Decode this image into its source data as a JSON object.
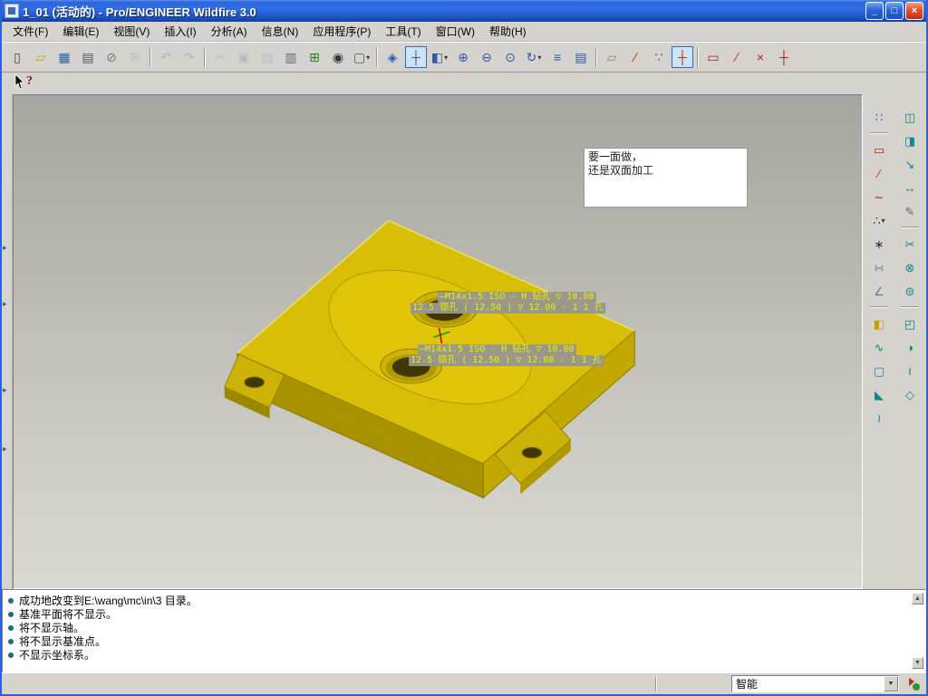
{
  "window": {
    "title": "1_01 (活动的) - Pro/ENGINEER Wildfire 3.0",
    "minimize_glyph": "_",
    "maximize_glyph": "□",
    "close_glyph": "×"
  },
  "menu": {
    "items": [
      {
        "id": "file",
        "label": "文件(F)"
      },
      {
        "id": "edit",
        "label": "编辑(E)"
      },
      {
        "id": "view",
        "label": "视图(V)"
      },
      {
        "id": "insert",
        "label": "插入(I)"
      },
      {
        "id": "analysis",
        "label": "分析(A)"
      },
      {
        "id": "info",
        "label": "信息(N)"
      },
      {
        "id": "applications",
        "label": "应用程序(P)"
      },
      {
        "id": "tools",
        "label": "工具(T)"
      },
      {
        "id": "window",
        "label": "窗口(W)"
      },
      {
        "id": "help",
        "label": "帮助(H)"
      }
    ]
  },
  "toolbar": {
    "caret_glyph": "▾",
    "groups": [
      {
        "items": [
          {
            "name": "new-file-button",
            "glyph": "▯",
            "color": "#444444"
          },
          {
            "name": "open-file-button",
            "glyph": "▱",
            "color": "#c8a000"
          },
          {
            "name": "save-file-button",
            "glyph": "▦",
            "color": "#2a5caa"
          },
          {
            "name": "print-button",
            "glyph": "▤",
            "color": "#555555"
          },
          {
            "name": "erase-display-button",
            "glyph": "⊘",
            "color": "#777777"
          },
          {
            "name": "send-email-button",
            "glyph": "✉",
            "color": "#999999",
            "disabled": true
          }
        ]
      },
      {
        "items": [
          {
            "name": "undo-button",
            "glyph": "↶",
            "color": "#888888",
            "disabled": true
          },
          {
            "name": "redo-button",
            "glyph": "↷",
            "color": "#888888",
            "disabled": true
          }
        ]
      },
      {
        "items": [
          {
            "name": "cut-button",
            "glyph": "✂",
            "color": "#999999",
            "disabled": true
          },
          {
            "name": "copy-button",
            "glyph": "▣",
            "color": "#999999",
            "disabled": true
          },
          {
            "name": "paste-button",
            "glyph": "▤",
            "color": "#999999",
            "disabled": true
          },
          {
            "name": "paste-special-button",
            "glyph": "▥",
            "color": "#666677"
          },
          {
            "name": "regenerate-button",
            "glyph": "⊞",
            "color": "#2a7a2a"
          },
          {
            "name": "find-button",
            "glyph": "◉",
            "color": "#333333"
          },
          {
            "name": "select-box-button",
            "glyph": "▢",
            "color": "#555555",
            "caret": true
          }
        ]
      },
      {
        "items": [
          {
            "name": "repaint-button",
            "glyph": "◈",
            "color": "#2a5caa"
          },
          {
            "name": "spin-center-toggle",
            "glyph": "┼",
            "color": "#2a5caa",
            "pressed": true
          },
          {
            "name": "saved-views-button",
            "glyph": "◧",
            "color": "#2a5caa",
            "caret": true
          },
          {
            "name": "zoom-in-button",
            "glyph": "⊕",
            "color": "#2a5caa"
          },
          {
            "name": "zoom-out-button",
            "glyph": "⊖",
            "color": "#2a5caa"
          },
          {
            "name": "refit-button",
            "glyph": "⊙",
            "color": "#2a5caa"
          },
          {
            "name": "reorient-button",
            "glyph": "↻",
            "color": "#2a5caa",
            "caret": true
          },
          {
            "name": "layers-button",
            "glyph": "≡",
            "color": "#2a5caa"
          },
          {
            "name": "view-manager-button",
            "glyph": "▤",
            "color": "#2a5caa"
          }
        ]
      },
      {
        "items": [
          {
            "name": "datum-planes-toggle",
            "glyph": "▱",
            "color": "#a07850"
          },
          {
            "name": "datum-axes-toggle",
            "glyph": "∕",
            "color": "#b03000"
          },
          {
            "name": "datum-points-toggle",
            "glyph": "∵",
            "color": "#2a5caa"
          },
          {
            "name": "datum-csys-toggle",
            "glyph": "┼",
            "color": "#b03000",
            "pressed": true
          }
        ]
      },
      {
        "items": [
          {
            "name": "create-datum-plane-button",
            "glyph": "▭",
            "color": "#aa2222"
          },
          {
            "name": "create-datum-axis-button",
            "glyph": "∕",
            "color": "#aa2222"
          },
          {
            "name": "create-datum-point-button",
            "glyph": "×",
            "color": "#aa2222"
          },
          {
            "name": "create-datum-csys-button",
            "glyph": "┼",
            "color": "#aa2222"
          }
        ]
      }
    ]
  },
  "cursor": {
    "help_glyph": "?"
  },
  "left_panel": {
    "arrow_glyph": "▸"
  },
  "right_toolbar": {
    "col_a": [
      {
        "name": "select-special-tool",
        "glyph": "∷",
        "color": "#2a5caa"
      },
      {
        "sep": true
      },
      {
        "name": "datum-plane-tool",
        "glyph": "▭",
        "color": "#b03000"
      },
      {
        "name": "datum-axis-tool",
        "glyph": "∕",
        "color": "#b03000"
      },
      {
        "name": "datum-curve-tool",
        "glyph": "∼",
        "color": "#b03000"
      },
      {
        "name": "datum-point-tool",
        "glyph": "∴",
        "color": "#333333",
        "caret": true
      },
      {
        "name": "datum-csys-tool",
        "glyph": "∗",
        "color": "#333333"
      },
      {
        "name": "reference-tool",
        "glyph": "∺",
        "color": "#777777"
      },
      {
        "name": "measure-tool",
        "glyph": "∠",
        "color": "#777777"
      },
      {
        "sep": true
      },
      {
        "name": "layer-tool",
        "glyph": "◧",
        "color": "#c8a000"
      },
      {
        "name": "graph-tool",
        "glyph": "∿",
        "color": "#0a8a8a"
      },
      {
        "name": "sketch-tool",
        "glyph": "▢",
        "color": "#0a8a8a"
      },
      {
        "name": "flag-annotation-tool",
        "glyph": "◣",
        "color": "#0a8a8a"
      },
      {
        "name": "curve-edit-tool",
        "glyph": "≀",
        "color": "#0a8a8a"
      }
    ],
    "col_b": [
      {
        "name": "copy-geometry-tool",
        "glyph": "◫",
        "color": "#0a8a8a"
      },
      {
        "name": "mirror-tool",
        "glyph": "◨",
        "color": "#0a8a8a"
      },
      {
        "name": "move-tool",
        "glyph": "↘",
        "color": "#0a8a8a"
      },
      {
        "name": "scale-tool",
        "glyph": "↔",
        "color": "#0a8a8a"
      },
      {
        "name": "annotation-tool",
        "glyph": "✎",
        "color": "#666666"
      },
      {
        "sep": true
      },
      {
        "name": "trim-tool",
        "glyph": "✂",
        "color": "#0a8a8a"
      },
      {
        "name": "intersect-tool",
        "glyph": "⊗",
        "color": "#0a8a8a"
      },
      {
        "name": "offset-tool",
        "glyph": "⊜",
        "color": "#0a8a8a"
      },
      {
        "sep": true
      },
      {
        "name": "extrude-tool",
        "glyph": "◰",
        "color": "#0a8a8a"
      },
      {
        "name": "revolve-tool",
        "glyph": "◑",
        "color": "#0a8a8a"
      },
      {
        "name": "sweep-tool",
        "glyph": "≀",
        "color": "#0a8a8a"
      },
      {
        "name": "blend-tool",
        "glyph": "◇",
        "color": "#0a8a8a"
      }
    ]
  },
  "viewport": {
    "note": {
      "line1": "要一面做，",
      "line2": "还是双面加工"
    },
    "callouts": [
      {
        "line1": "—M14x1.5 ISO - H 钻孔 ▽ 10.00",
        "line2": "12.5 锪孔 ( 12.50 ) ▽ 12.00 - 1 1 孔"
      },
      {
        "line1": "—M14x1.5 ISO - H 钻孔 ▽ 10.00",
        "line2": "12.5 锪孔 ( 12.50 ) ▽ 12.00 - 1 1 孔"
      }
    ]
  },
  "messages": {
    "scroll_up_glyph": "▲",
    "scroll_down_glyph": "▼",
    "lines": [
      "成功地改变到E:\\wang\\mc\\in\\3 目录。",
      "基准平面将不显示。",
      "将不显示轴。",
      "将不显示基准点。",
      "不显示坐标系。"
    ]
  },
  "statusbar": {
    "filter_label": "智能",
    "dropdown_glyph": "▼"
  },
  "colors": {
    "titlebar_blue": "#2a63d8",
    "chrome_gray": "#d6d3ce",
    "part_yellow": "#d9be07",
    "part_shadow_yellow": "#a89200",
    "dimension_text_yellow": "#eded00",
    "viewport_top_gray": "#a6a6a0",
    "viewport_bottom_gray": "#dadad2",
    "message_bullet_teal": "#17708a"
  }
}
